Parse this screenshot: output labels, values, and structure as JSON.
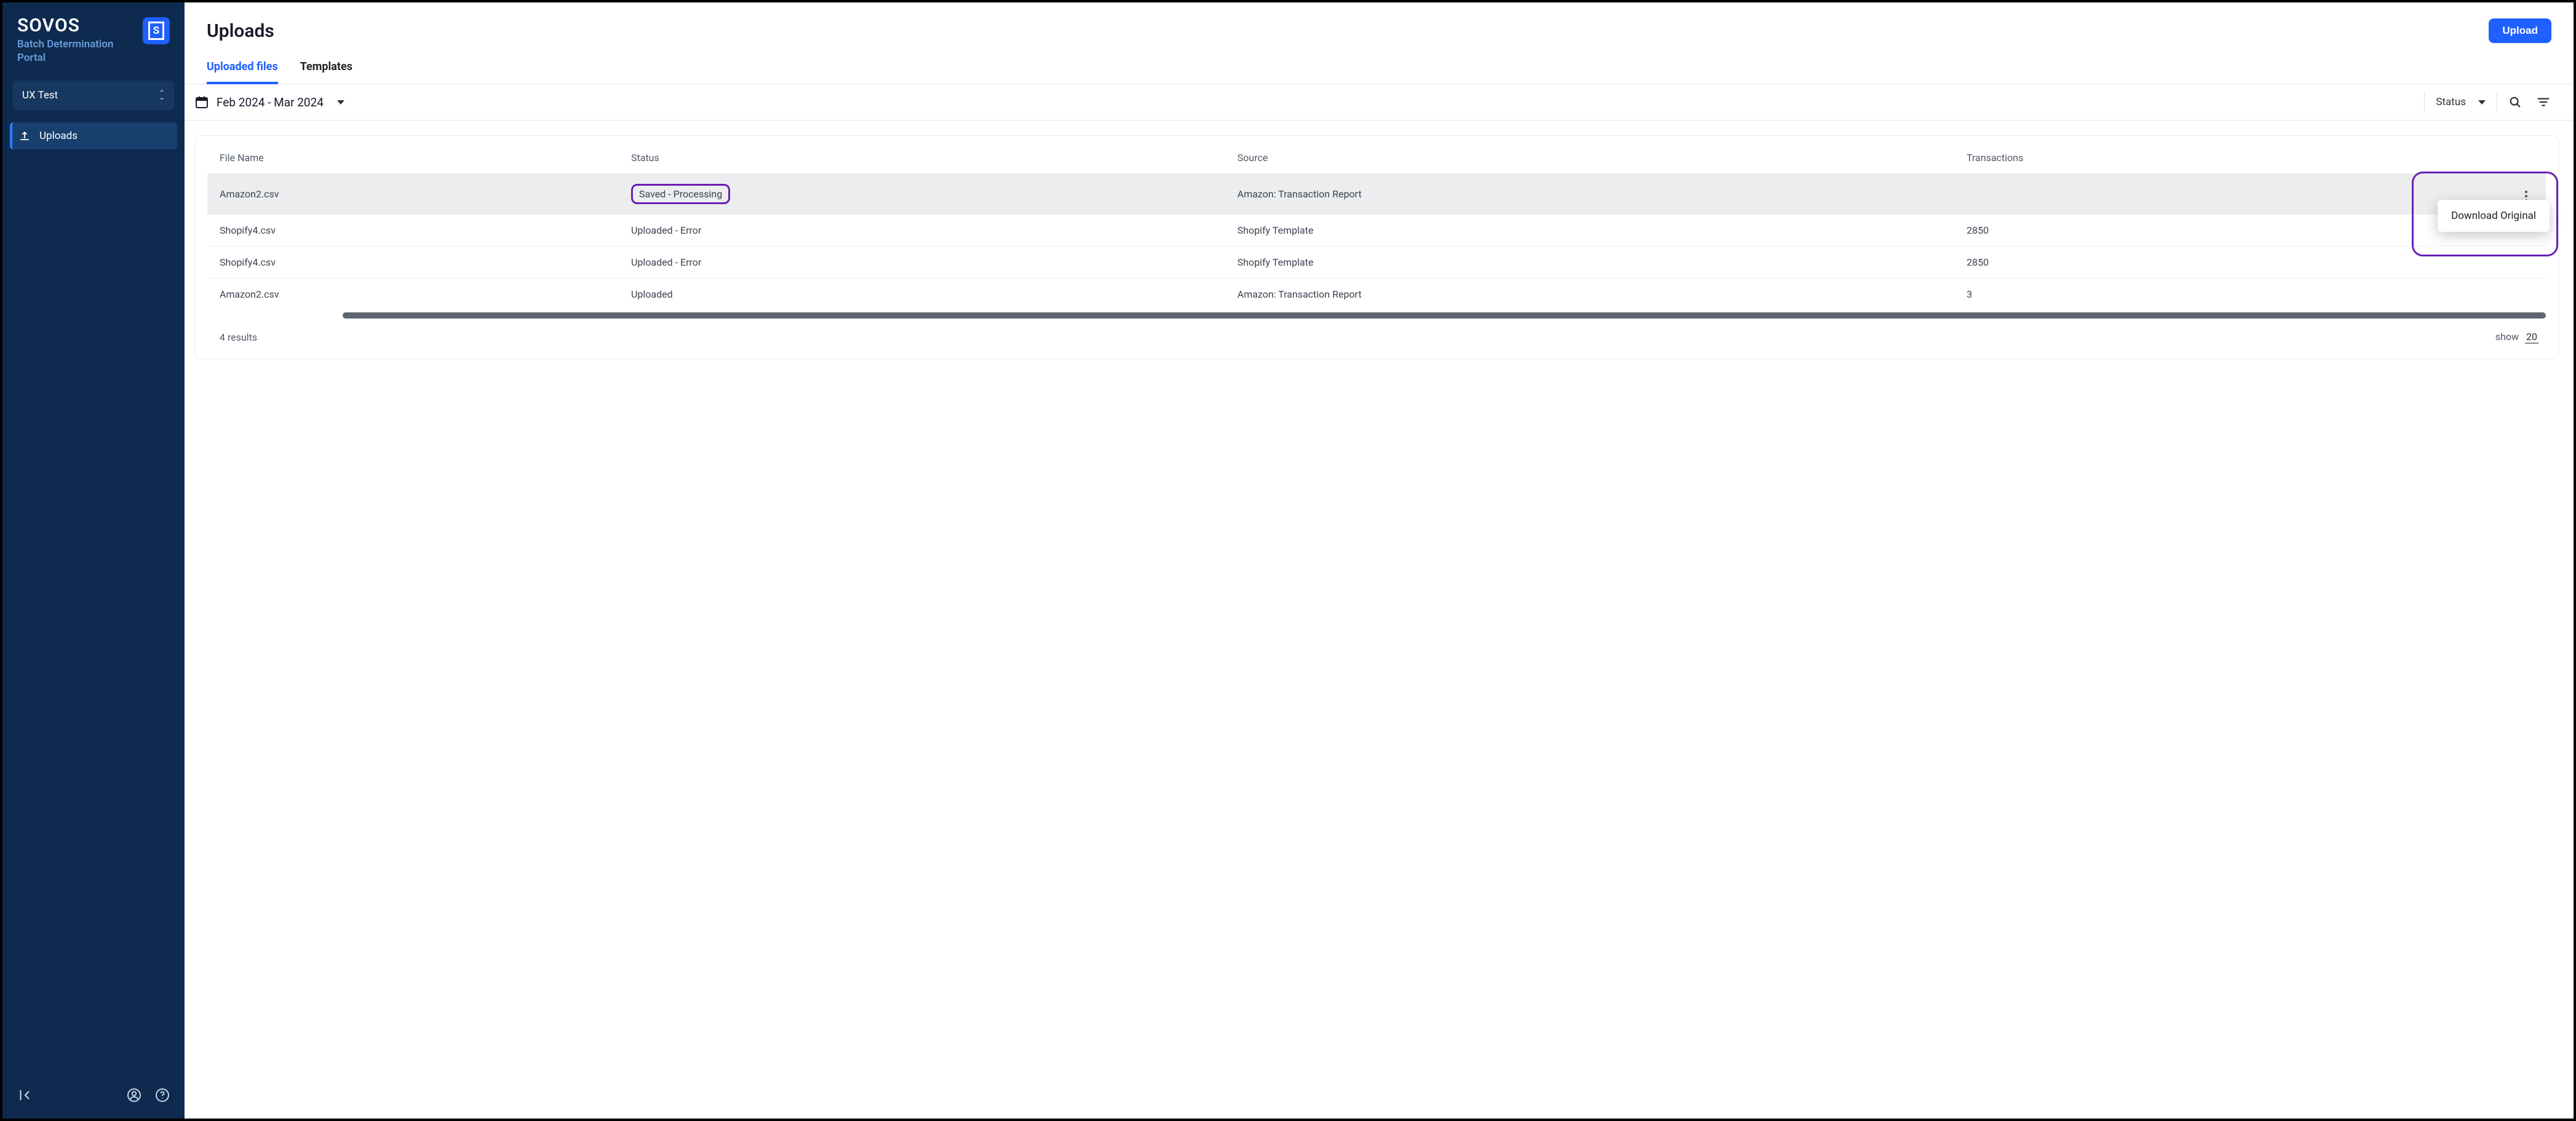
{
  "brand": {
    "name": "SOVOS",
    "subtitle": "Batch Determination Portal",
    "icon_letter": "S"
  },
  "org_selector": {
    "label": "UX Test"
  },
  "nav": {
    "items": [
      {
        "label": "Uploads",
        "active": true
      }
    ]
  },
  "header": {
    "title": "Uploads",
    "upload_button": "Upload"
  },
  "tabs": [
    {
      "label": "Uploaded files",
      "active": true
    },
    {
      "label": "Templates",
      "active": false
    }
  ],
  "toolbar": {
    "date_range": "Feb 2024 - Mar 2024",
    "status_filter_label": "Status"
  },
  "table": {
    "columns": [
      "File Name",
      "Status",
      "Source",
      "Transactions",
      ""
    ],
    "rows": [
      {
        "file": "Amazon2.csv",
        "status": "Saved - Processing",
        "source": "Amazon: Transaction Report",
        "tx": "",
        "selected": true,
        "status_outlined": true
      },
      {
        "file": "Shopify4.csv",
        "status": "Uploaded - Error",
        "source": "Shopify Template",
        "tx": "2850"
      },
      {
        "file": "Shopify4.csv",
        "status": "Uploaded - Error",
        "source": "Shopify Template",
        "tx": "2850"
      },
      {
        "file": "Amazon2.csv",
        "status": "Uploaded",
        "source": "Amazon: Transaction Report",
        "tx": "3"
      }
    ],
    "results_text": "4 results",
    "show_label": "show",
    "show_value": "20"
  },
  "menu": {
    "download_original": "Download Original"
  }
}
